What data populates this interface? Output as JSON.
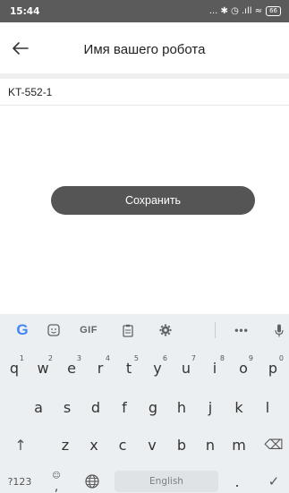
{
  "status_bar": {
    "time": "15:44",
    "icons_text": "... ✱ ◷ .ıll ≈",
    "battery": "66"
  },
  "app_bar": {
    "title": "Имя вашего робота",
    "back_icon": "arrow-left-icon"
  },
  "name_input": {
    "value": "KT-552-1"
  },
  "save_button": {
    "label": "Сохранить"
  },
  "keyboard": {
    "toolbar": {
      "g_label": "G",
      "gif_label": "GIF",
      "more_label": "•••",
      "icons": [
        "google-g-icon",
        "sticker-icon",
        "gif-icon",
        "clipboard-icon",
        "settings-gear-icon",
        "more-icon",
        "mic-icon"
      ]
    },
    "row1": [
      {
        "char": "q",
        "hint": "1"
      },
      {
        "char": "w",
        "hint": "2"
      },
      {
        "char": "e",
        "hint": "3"
      },
      {
        "char": "r",
        "hint": "4"
      },
      {
        "char": "t",
        "hint": "5"
      },
      {
        "char": "y",
        "hint": "6"
      },
      {
        "char": "u",
        "hint": "7"
      },
      {
        "char": "i",
        "hint": "8"
      },
      {
        "char": "o",
        "hint": "9"
      },
      {
        "char": "p",
        "hint": "0"
      }
    ],
    "row2": [
      "a",
      "s",
      "d",
      "f",
      "g",
      "h",
      "j",
      "k",
      "l"
    ],
    "row3": [
      "z",
      "x",
      "c",
      "v",
      "b",
      "n",
      "m"
    ],
    "shift_symbol": "↑",
    "backspace_symbol": "⌫",
    "symbols_label": "?123",
    "emoji_symbol": "☺",
    "comma": ",",
    "space_label": "English",
    "period": ".",
    "enter_symbol": "✓"
  }
}
